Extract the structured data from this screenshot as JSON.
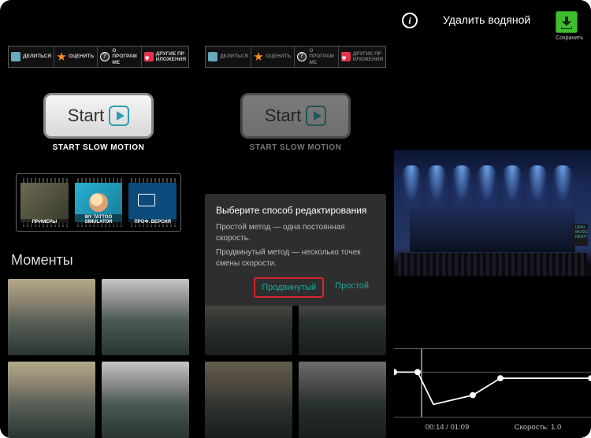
{
  "toolbar": {
    "share": "Делиться",
    "rate": "Оценить",
    "about": "О ПРОГРАМ МЕ",
    "other": "ДРУГИЕ ПР ИЛОЖЕНИЯ"
  },
  "start": {
    "btn": "Start",
    "caption": "START SLOW MOTION"
  },
  "cards": {
    "examples": "ПРИМЕРЫ",
    "tattoo": "MY TATTOO SIMULATOR",
    "pro": "ПРОФ. ВЕРСИЯ"
  },
  "moments_title": "Моменты",
  "dialog": {
    "title": "Выберите способ редактирования",
    "line1": "Простой метод — одна постоянная скорость.",
    "line2": "Продвинутый метод — несколько точек смены скорости.",
    "advanced": "Продвинутый",
    "simple": "Простой"
  },
  "p3": {
    "watermark": "Удалить водяной",
    "save": "Сохранить",
    "sign": "URAL MUSIC NIGHT",
    "time": "00:14 / 01:09",
    "speed": "Скорость: 1.0"
  }
}
